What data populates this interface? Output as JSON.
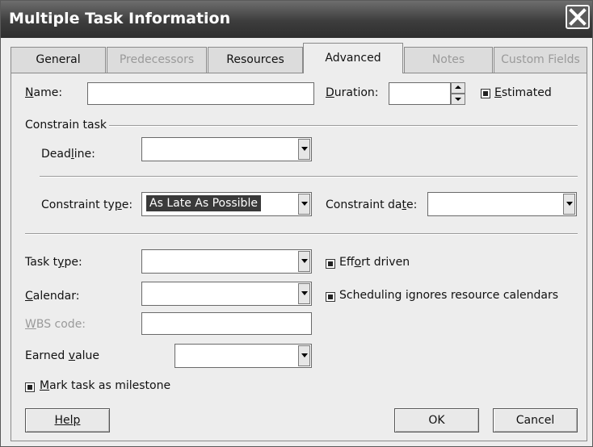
{
  "window": {
    "title": "Multiple Task Information"
  },
  "tabs": [
    {
      "label": "General",
      "state": "normal"
    },
    {
      "label": "Predecessors",
      "state": "disabled"
    },
    {
      "label": "Resources",
      "state": "normal"
    },
    {
      "label": "Advanced",
      "state": "active"
    },
    {
      "label": "Notes",
      "state": "disabled"
    },
    {
      "label": "Custom Fields",
      "state": "disabled"
    }
  ],
  "form": {
    "name": {
      "label": "Name:",
      "value": ""
    },
    "duration": {
      "label": "Duration:",
      "value": ""
    },
    "estimated": {
      "label": "Estimated",
      "checked": true
    },
    "constrain_group": {
      "label": "Constrain task"
    },
    "deadline": {
      "label": "Deadline:",
      "value": ""
    },
    "constraint_type": {
      "label": "Constraint type:",
      "value": "As Late As Possible"
    },
    "constraint_date": {
      "label": "Constraint date:",
      "value": ""
    },
    "task_type": {
      "label": "Task type:",
      "value": ""
    },
    "effort_driven": {
      "label": "Effort driven",
      "checked": true
    },
    "calendar": {
      "label": "Calendar:",
      "value": ""
    },
    "scheduling_ignores": {
      "label": "Scheduling ignores resource calendars",
      "checked": true
    },
    "wbs_code": {
      "label": "WBS code:",
      "value": "",
      "disabled": true
    },
    "earned_value": {
      "label": "Earned value",
      "value": ""
    },
    "milestone": {
      "label": "Mark task as milestone",
      "checked": true
    }
  },
  "buttons": {
    "help": "Help",
    "ok": "OK",
    "cancel": "Cancel"
  },
  "icons": {
    "close": "close-icon",
    "dropdown": "chevron-down-icon",
    "spin_up": "spin-up-icon",
    "spin_down": "spin-down-icon"
  }
}
